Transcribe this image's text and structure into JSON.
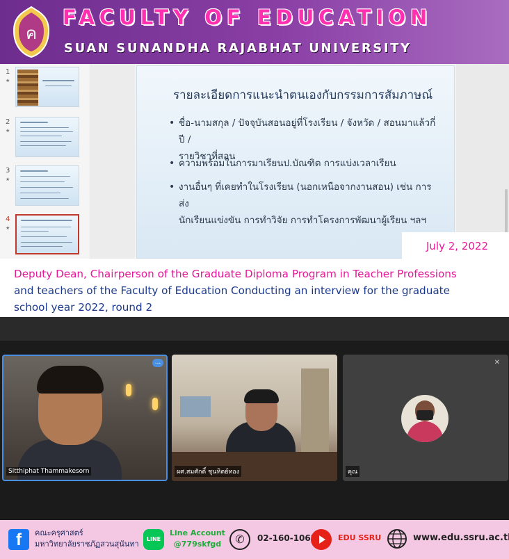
{
  "header": {
    "title": "FACULTY OF EDUCATION",
    "subtitle": "SUAN SUNANDHA RAJABHAT UNIVERSITY",
    "seal_text": "ค"
  },
  "slides_panel": {
    "thumbnails": [
      {
        "num": "1",
        "title_line": "บทสรุป : คู่มือ/แนวทางการสัมภาษณ์",
        "active": false
      },
      {
        "num": "2",
        "title_line": "ตรวจสอบข้อมูลผู้สมัคร",
        "active": false
      },
      {
        "num": "3",
        "title_line": "ตรวจสอบข้อมูลผู้สมัคร",
        "active": false
      },
      {
        "num": "4",
        "title_line": "รายละเอียดการแนะนำตนเองกับกรรมการสัมภาษณ์",
        "active": true
      }
    ]
  },
  "slide": {
    "title": "รายละเอียดการแนะนำตนเองกับกรรมการสัมภาษณ์",
    "bullets": [
      {
        "line1": "ชื่อ-นามสกุล / ปัจจุบันสอนอยู่ที่โรงเรียน / จังหวัด / สอนมาแล้วกี่ปี /",
        "line2": "รายวิชาที่สอน"
      },
      {
        "line1": "ความพร้อมในการมาเรียนป.บัณฑิต การแบ่งเวลาเรียน",
        "line2": ""
      },
      {
        "line1": "งานอื่นๆ ที่เคยทำในโรงเรียน (นอกเหนือจากงานสอน) เช่น การส่ง",
        "line2": "นักเรียนแข่งขัน การทำวิจัย การทำโครงการพัฒนาผู้เรียน ฯลฯ"
      }
    ]
  },
  "date": "July 2, 2022",
  "caption": {
    "line1": "Deputy Dean, Chairperson of the Graduate Diploma Program in Teacher Professions",
    "line2": "and teachers of the Faculty of Education Conducting an interview for the graduate",
    "line3": "school year 2022, round 2"
  },
  "meeting": {
    "participants": [
      {
        "name": "Sitthiphat Thammakesorn"
      },
      {
        "name": "ผศ.สมศักดิ์ ชุนหิตย์ทอง"
      },
      {
        "name": "คุณ"
      }
    ],
    "more_icon": "...",
    "mute_icon": "mic-off-icon"
  },
  "footer": {
    "facebook_line1": "คณะครุศาสตร์",
    "facebook_line2": "มหาวิทยาลัยราชภัฏสวนสุนันทา",
    "line_label": "LINE",
    "line_line1": "Line Account",
    "line_line2": "@779skfgd",
    "phone": "02-160-1062",
    "youtube": "EDU SSRU",
    "website": "www.edu.ssru.ac.th"
  },
  "colors": {
    "header_purple": "#8a3fa5",
    "title_pink": "#ff2fb0",
    "caption_pink": "#e8179a",
    "caption_blue": "#1c3a8c",
    "footer_pink": "#f4c7e3"
  }
}
